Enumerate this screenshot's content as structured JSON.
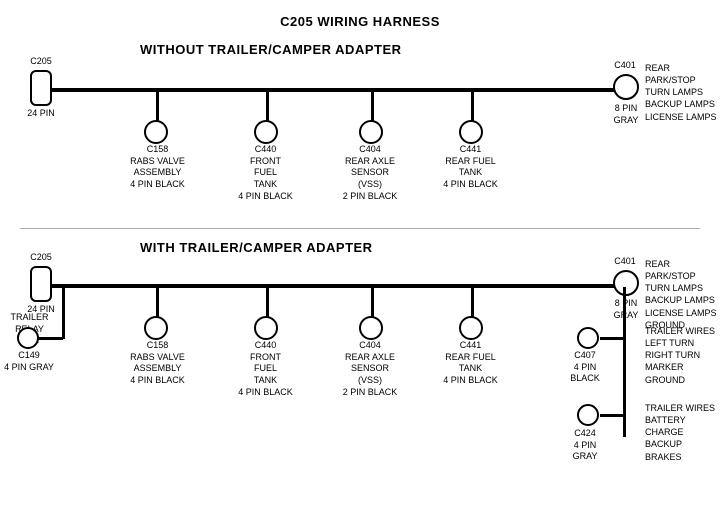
{
  "title": "C205 WIRING HARNESS",
  "section1": {
    "label": "WITHOUT  TRAILER/CAMPER  ADAPTER",
    "connectors": [
      {
        "id": "C205_1",
        "type": "rect",
        "label": "C205",
        "sublabel": "24 PIN"
      },
      {
        "id": "C401_1",
        "type": "circle",
        "label": "C401",
        "sublabel": "8 PIN\nGRAY"
      },
      {
        "id": "C158_1",
        "type": "circle",
        "label": "C158"
      },
      {
        "id": "C440_1",
        "type": "circle",
        "label": "C440"
      },
      {
        "id": "C404_1",
        "type": "circle",
        "label": "C404"
      },
      {
        "id": "C441_1",
        "type": "circle",
        "label": "C441"
      }
    ],
    "c401_desc": "REAR PARK/STOP\nTURN LAMPS\nBACKUP LAMPS\nLICENSE LAMPS",
    "c158_desc": "RABS VALVE\nASSEMBLY\n4 PIN BLACK",
    "c440_desc": "FRONT FUEL\nTANK\n4 PIN BLACK",
    "c404_desc": "REAR AXLE\nSENSOR\n(VSS)\n2 PIN BLACK",
    "c441_desc": "REAR FUEL\nTANK\n4 PIN BLACK"
  },
  "section2": {
    "label": "WITH  TRAILER/CAMPER  ADAPTER",
    "connectors": [
      {
        "id": "C205_2",
        "type": "rect",
        "label": "C205",
        "sublabel": "24 PIN"
      },
      {
        "id": "C401_2",
        "type": "circle",
        "label": "C401",
        "sublabel": "8 PIN\nGRAY"
      },
      {
        "id": "C158_2",
        "type": "circle",
        "label": "C158"
      },
      {
        "id": "C440_2",
        "type": "circle",
        "label": "C440"
      },
      {
        "id": "C404_2",
        "type": "circle",
        "label": "C404"
      },
      {
        "id": "C441_2",
        "type": "circle",
        "label": "C441"
      },
      {
        "id": "C149",
        "type": "circle",
        "label": "C149",
        "sublabel": "4 PIN GRAY"
      },
      {
        "id": "C407",
        "type": "circle",
        "label": "C407",
        "sublabel": "4 PIN\nBLACK"
      },
      {
        "id": "C424",
        "type": "circle",
        "label": "C424",
        "sublabel": "4 PIN\nGRAY"
      }
    ],
    "c401_desc": "REAR PARK/STOP\nTURN LAMPS\nBACKUP LAMPS\nLICENSE LAMPS\nGROUND",
    "c158_desc": "RABS VALVE\nASSEMBLY\n4 PIN BLACK",
    "c440_desc": "FRONT FUEL\nTANK\n4 PIN BLACK",
    "c404_desc": "REAR AXLE\nSENSOR\n(VSS)\n2 PIN BLACK",
    "c441_desc": "REAR FUEL\nTANK\n4 PIN BLACK",
    "trailer_relay": "TRAILER\nRELAY\nBOX",
    "c407_desc": "TRAILER WIRES\nLEFT TURN\nRIGHT TURN\nMARKER\nGROUND",
    "c424_desc": "TRAILER WIRES\nBATTERY CHARGE\nBACKUP\nBRAKES"
  }
}
